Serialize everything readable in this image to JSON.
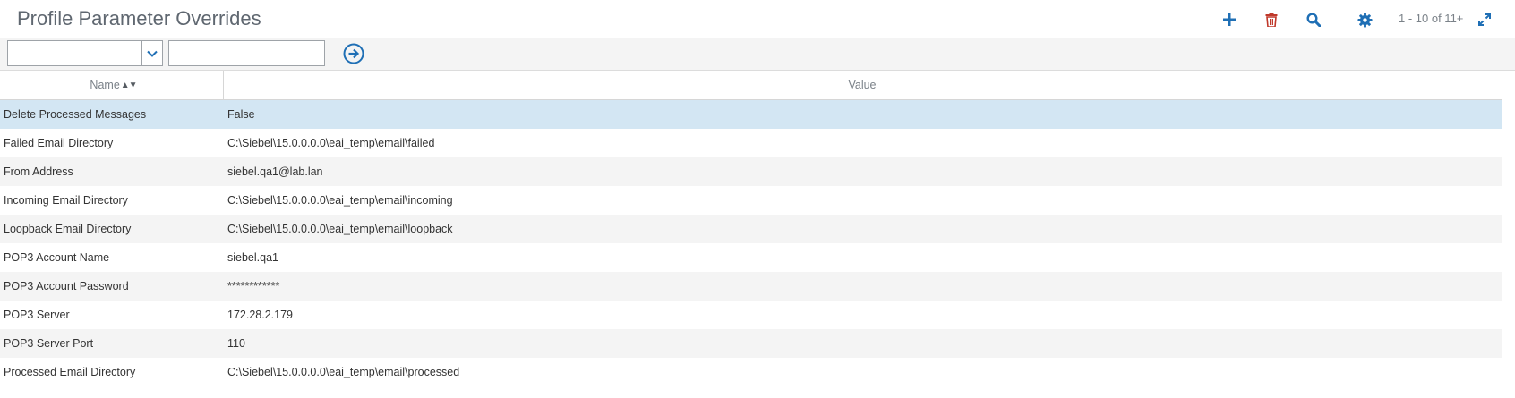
{
  "header": {
    "title": "Profile Parameter Overrides",
    "record_count": "1 - 10 of 11+",
    "icons": [
      "plus-icon",
      "trash-icon",
      "search-icon",
      "gear-icon",
      "expand-icon"
    ],
    "accent_color": "#1f6fb5",
    "delete_color": "#c0392b"
  },
  "query": {
    "field_value": "",
    "input_value": "",
    "input_placeholder": ""
  },
  "grid": {
    "columns": [
      "Name",
      "Value"
    ],
    "sort_indicator": "▲▼",
    "selected_row_color": "#d3e6f3",
    "rows": [
      {
        "name": "Delete Processed Messages",
        "value": "False",
        "selected": true
      },
      {
        "name": "Failed Email Directory",
        "value": "C:\\Siebel\\15.0.0.0.0\\eai_temp\\email\\failed"
      },
      {
        "name": "From Address",
        "value": "siebel.qa1@lab.lan"
      },
      {
        "name": "Incoming Email Directory",
        "value": "C:\\Siebel\\15.0.0.0.0\\eai_temp\\email\\incoming"
      },
      {
        "name": "Loopback Email Directory",
        "value": "C:\\Siebel\\15.0.0.0.0\\eai_temp\\email\\loopback"
      },
      {
        "name": "POP3 Account Name",
        "value": "siebel.qa1"
      },
      {
        "name": "POP3 Account Password",
        "value": "************"
      },
      {
        "name": "POP3 Server",
        "value": "172.28.2.179"
      },
      {
        "name": "POP3 Server Port",
        "value": "110"
      },
      {
        "name": "Processed Email Directory",
        "value": "C:\\Siebel\\15.0.0.0.0\\eai_temp\\email\\processed"
      }
    ]
  }
}
